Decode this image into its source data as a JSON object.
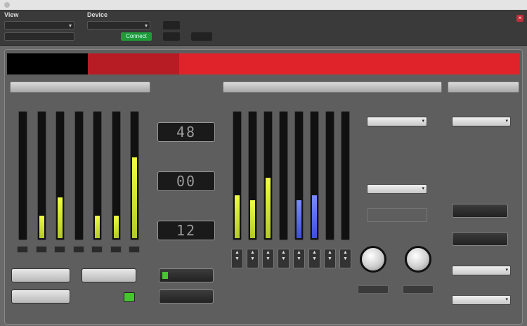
{
  "header": {
    "view_label": "View",
    "device_label": "Device",
    "view_value": "",
    "device_value": "",
    "sub_value": "",
    "connect_label": "Connect",
    "rate_label": "",
    "rate_value": "",
    "rate_value2": "",
    "aux_label": "",
    "aux_value": ""
  },
  "colors": {
    "accent": "#e0232b",
    "meter": "#d6e83a",
    "led": "#44c72d",
    "panel": "#5e5e5e"
  },
  "title": "",
  "sections": {
    "left": "",
    "center": "",
    "right": ""
  },
  "meters_left": [
    {
      "level": 0.0,
      "label": "",
      "peak": 0.0
    },
    {
      "level": 0.18,
      "label": "",
      "peak": 0.0
    },
    {
      "level": 0.32,
      "label": "",
      "peak": 0.0
    },
    {
      "level": 0.0,
      "label": "",
      "peak": 0.0
    },
    {
      "level": 0.18,
      "label": "",
      "peak": 0.0
    },
    {
      "level": 0.18,
      "label": "",
      "peak": 0.0
    },
    {
      "level": 0.64,
      "label": "",
      "peak": 0.0
    }
  ],
  "lcds": [
    {
      "caption": "",
      "value": "48"
    },
    {
      "caption": "",
      "value": "00"
    },
    {
      "caption": "",
      "value": "12"
    }
  ],
  "meters_center": [
    {
      "level": 0.34,
      "blue": false
    },
    {
      "level": 0.3,
      "blue": false
    },
    {
      "level": 0.48,
      "blue": false
    },
    {
      "level": 0.0,
      "blue": false
    },
    {
      "level": 0.3,
      "blue": true
    },
    {
      "level": 0.34,
      "blue": true
    },
    {
      "level": 0.0,
      "blue": false
    },
    {
      "level": 0.0,
      "blue": false
    }
  ],
  "left_buttons": {
    "b1": "",
    "b2": "",
    "b3": "",
    "led_label": ""
  },
  "center_buttons": {
    "b1": "",
    "b2": ""
  },
  "selects": {
    "s1": "",
    "s2": ""
  },
  "right": {
    "sel1": "",
    "sel2": "",
    "sel3": "",
    "btn1": "",
    "btn2": "",
    "cap1": "",
    "cap2": "",
    "cap3": "",
    "cap4": ""
  },
  "knobs": [
    {
      "label": ""
    },
    {
      "label": ""
    }
  ]
}
